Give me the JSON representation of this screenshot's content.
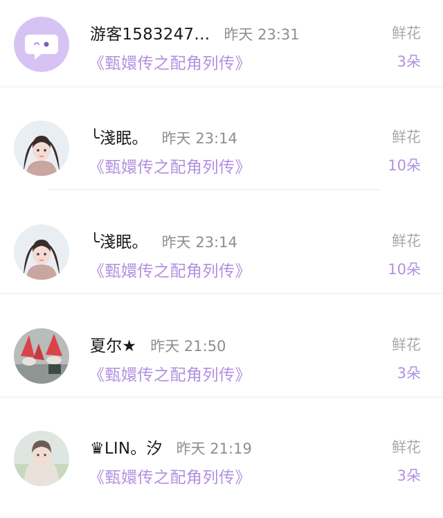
{
  "entries": [
    {
      "name": "游客1583247…",
      "time": "昨天 23:31",
      "book": "《甄嬛传之配角列传》",
      "gift_label": "鲜花",
      "gift_count": "3朵",
      "avatar_icon": "chat-bubble-icon"
    },
    {
      "name": "╰淺眠。",
      "time": "昨天 23:14",
      "book": "《甄嬛传之配角列传》",
      "gift_label": "鲜花",
      "gift_count": "10朵",
      "avatar_icon": "girl-portrait-avatar"
    },
    {
      "name": "╰淺眠。",
      "time": "昨天 23:14",
      "book": "《甄嬛传之配角列传》",
      "gift_label": "鲜花",
      "gift_count": "10朵",
      "avatar_icon": "girl-portrait-avatar"
    },
    {
      "name": "夏尔★",
      "time": "昨天 21:50",
      "book": "《甄嬛传之配角列传》",
      "gift_label": "鲜花",
      "gift_count": "3朵",
      "avatar_icon": "red-hats-photo-avatar"
    },
    {
      "name": "♛LIN。汐",
      "time": "昨天 21:19",
      "book": "《甄嬛传之配角列传》",
      "gift_label": "鲜花",
      "gift_count": "3朵",
      "avatar_icon": "girl-photo-avatar"
    }
  ],
  "colors": {
    "accent": "#b290e0",
    "placeholder_avatar": "#d6c3f3",
    "name_text": "#1a1a1a",
    "time_text": "#8e8e8e",
    "gift_label_text": "#a9a9a9",
    "divider": "#ececec"
  }
}
